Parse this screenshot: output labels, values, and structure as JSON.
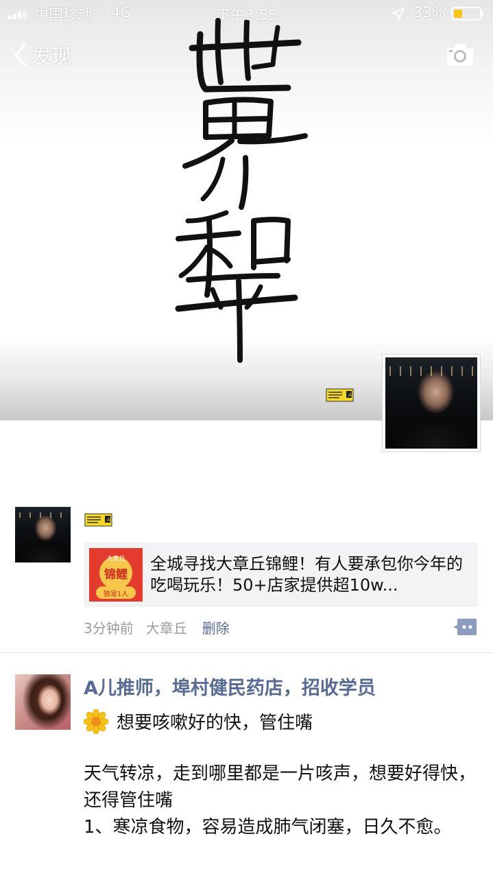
{
  "status_bar": {
    "carrier": "中国移动",
    "network": "4G",
    "time": "下午3:55",
    "battery_percent": "33%",
    "battery_level": 0.33
  },
  "nav": {
    "back_label": "发现"
  },
  "cover": {
    "calligraphy_lines": [
      "世",
      "界",
      "和",
      "平"
    ]
  },
  "posts": [
    {
      "share_card": {
        "thumb_top_text": "大章丘",
        "thumb_main_text": "锦鲤",
        "thumb_bottom_text": "独宠1人",
        "text": "全城寻找大章丘锦鲤！有人要承包你今年的吃喝玩乐！50+店家提供超10w..."
      },
      "time_ago": "3分钟前",
      "location": "大章丘",
      "delete_label": "删除"
    },
    {
      "author": "A儿推师，埠村健民药店，招收学员",
      "first_line": "想要咳嗽好的快，管住嘴",
      "body_lines": [
        "天气转凉，走到哪里都是一片咳声，想要好得快，还得管住嘴",
        "1、寒凉食物，容易造成肺气闭塞，日久不愈。"
      ]
    }
  ],
  "colors": {
    "link_blue": "#576b95",
    "card_bg": "#f3f3f5",
    "meta_gray": "#9b9b9b"
  }
}
